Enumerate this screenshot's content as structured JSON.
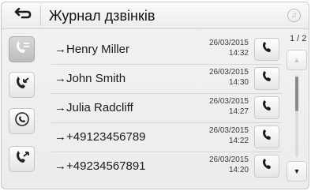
{
  "header": {
    "title": "Журнал дзвінків",
    "back_icon": "back-arrow-icon",
    "music_icon": "music-note-icon"
  },
  "filters": [
    {
      "name": "all-calls",
      "icon": "all-calls-icon",
      "active": true
    },
    {
      "name": "received-calls",
      "icon": "incoming-call-icon",
      "active": false
    },
    {
      "name": "missed-calls",
      "icon": "missed-call-icon",
      "active": false
    },
    {
      "name": "dialed-calls",
      "icon": "outgoing-call-icon",
      "active": false
    }
  ],
  "calls": [
    {
      "name": "Henry Miller",
      "date": "26/03/2015",
      "time": "14:32"
    },
    {
      "name": "John Smith",
      "date": "26/03/2015",
      "time": "14:30"
    },
    {
      "name": "Julia Radcliff",
      "date": "26/03/2015",
      "time": "14:27"
    },
    {
      "name": "+49123456789",
      "date": "26/03/2015",
      "time": "14:22"
    },
    {
      "name": "+49234567891",
      "date": "26/03/2015",
      "time": "14:20"
    }
  ],
  "pagination": {
    "indicator": "1 / 2"
  },
  "colors": {
    "active_filter": "#c6c6c6",
    "background": "#efefef"
  }
}
